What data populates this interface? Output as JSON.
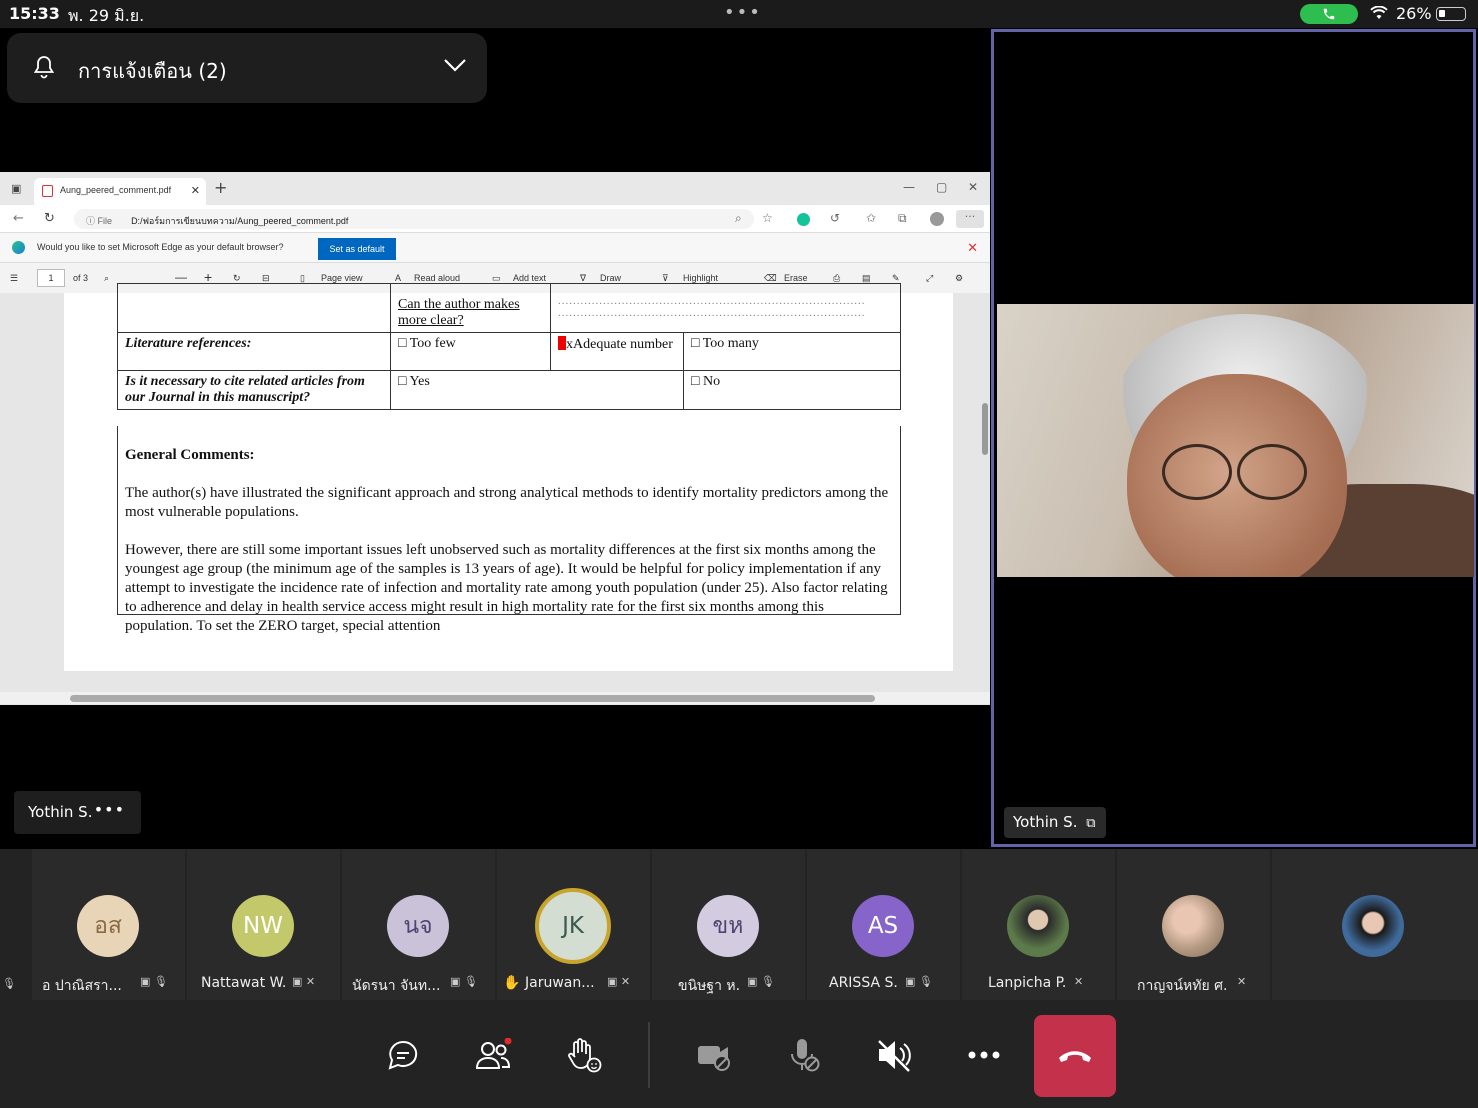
{
  "status": {
    "time": "15:33",
    "date": "พ. 29 มิ.ย.",
    "battery": "26%"
  },
  "notification": {
    "text": "การแจ้งเตือน (2)"
  },
  "browser": {
    "tab_title": "Aung_peered_comment.pdf",
    "url_label": "File",
    "url": "D:/ฟอร์มการเขียนบทความ/Aung_peered_comment.pdf",
    "infobar_text": "Would you like to set Microsoft Edge as your default browser?",
    "set_default": "Set as default",
    "page_number": "1",
    "page_of": "of 3",
    "tools": {
      "page_view": "Page view",
      "read_aloud": "Read aloud",
      "add_text": "Add text",
      "draw": "Draw",
      "highlight": "Highlight",
      "erase": "Erase"
    }
  },
  "document": {
    "row0_option": "Can the author makes more clear?",
    "row1_label": "Literature references:",
    "row1_opt1": "Too few",
    "row1_opt2": "xAdequate number",
    "row1_opt3": "Too many",
    "row2_label": "Is it necessary to cite related articles from our Journal in this manuscript?",
    "row2_opt1": "Yes",
    "row2_opt2": "No",
    "general_heading": "General Comments:",
    "para1": "The author(s) have illustrated the significant approach and strong analytical methods to identify mortality predictors among the most vulnerable populations.",
    "para2": "However, there are still some important issues left unobserved such as mortality differences at the first six months among the youngest age group (the minimum age of the samples is 13 years of age). It would be helpful for policy implementation if any attempt to investigate the incidence rate of infection and mortality rate among youth population (under 25). Also factor relating to adherence and delay in health service access might result in high mortality rate for the first six months among this population. To set the ZERO target, special attention"
  },
  "presenter_label": "Yothin S.",
  "video_label": "Yothin S.",
  "participants": [
    {
      "initials": "อส",
      "name": "อ ปาณิสรา...",
      "color": "#e8d5b8",
      "text_color": "#8a6a45"
    },
    {
      "initials": "NW",
      "name": "Nattawat W.",
      "color": "#c3c96a",
      "text_color": "#ffffff"
    },
    {
      "initials": "นจ",
      "name": "นัดรนา จันท...",
      "color": "#c9c2d9",
      "text_color": "#4c4670"
    },
    {
      "initials": "JK",
      "name": "Jaruwan...",
      "color": "#d3ddd1",
      "text_color": "#3a5a50"
    },
    {
      "initials": "ขห",
      "name": "ขนิษฐา ห.",
      "color": "#d3cbe0",
      "text_color": "#4c4670"
    },
    {
      "initials": "AS",
      "name": "ARISSA S.",
      "color": "#8664c9",
      "text_color": "#ffffff"
    },
    {
      "initials": "",
      "name": "Lanpicha P.",
      "color": "#4a5a3a",
      "text_color": "#ffffff"
    },
    {
      "initials": "",
      "name": "กาญจน์หทัย ศ.",
      "color": "#a89380",
      "text_color": "#ffffff"
    },
    {
      "initials": "",
      "name": "",
      "color": "#2c4b6e",
      "text_color": "#ffffff"
    }
  ]
}
